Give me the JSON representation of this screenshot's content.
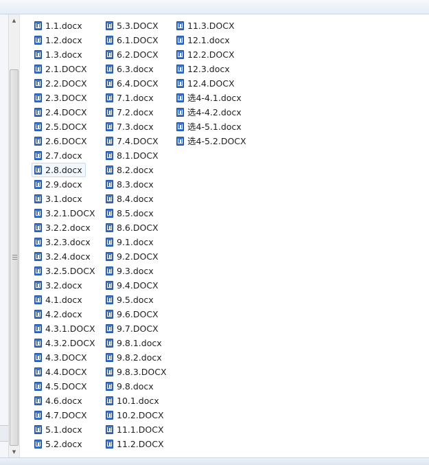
{
  "files": {
    "column1": [
      "1.1.docx",
      "1.2.docx",
      "1.3.docx",
      "2.1.DOCX",
      "2.2.DOCX",
      "2.3.DOCX",
      "2.4.DOCX",
      "2.5.DOCX",
      "2.6.DOCX",
      "2.7.docx",
      "2.8.docx",
      "2.9.docx",
      "3.1.docx",
      "3.2.1.DOCX",
      "3.2.2.docx",
      "3.2.3.docx",
      "3.2.4.docx",
      "3.2.5.DOCX",
      "3.2.docx",
      "4.1.docx",
      "4.2.docx",
      "4.3.1.DOCX",
      "4.3.2.DOCX",
      "4.3.DOCX",
      "4.4.DOCX",
      "4.5.DOCX",
      "4.6.docx",
      "4.7.DOCX",
      "5.1.docx",
      "5.2.docx"
    ],
    "column2": [
      "5.3.DOCX",
      "6.1.DOCX",
      "6.2.DOCX",
      "6.3.docx",
      "6.4.DOCX",
      "7.1.docx",
      "7.2.docx",
      "7.3.docx",
      "7.4.DOCX",
      "8.1.DOCX",
      "8.2.docx",
      "8.3.docx",
      "8.4.docx",
      "8.5.docx",
      "8.6.DOCX",
      "9.1.docx",
      "9.2.DOCX",
      "9.3.docx",
      "9.4.DOCX",
      "9.5.docx",
      "9.6.DOCX",
      "9.7.DOCX",
      "9.8.1.docx",
      "9.8.2.docx",
      "9.8.3.DOCX",
      "9.8.docx",
      "10.1.docx",
      "10.2.DOCX",
      "11.1.DOCX",
      "11.2.DOCX"
    ],
    "column3": [
      "11.3.DOCX",
      "12.1.docx",
      "12.2.DOCX",
      "12.3.docx",
      "12.4.DOCX",
      "选4-4.1.docx",
      "选4-4.2.docx",
      "选4-5.1.docx",
      "选4-5.2.DOCX"
    ]
  },
  "selected_file": "2.8.docx",
  "icons": {
    "file": "word-document-icon",
    "scroll_up": "scroll-up-arrow-icon",
    "scroll_down": "scroll-down-arrow-icon",
    "scroll_grip": "scroll-grip-icon"
  },
  "colors": {
    "icon_blue": "#3a73c9",
    "selection_bg": "#f2f7fd",
    "selection_border": "#c5d9f1"
  }
}
